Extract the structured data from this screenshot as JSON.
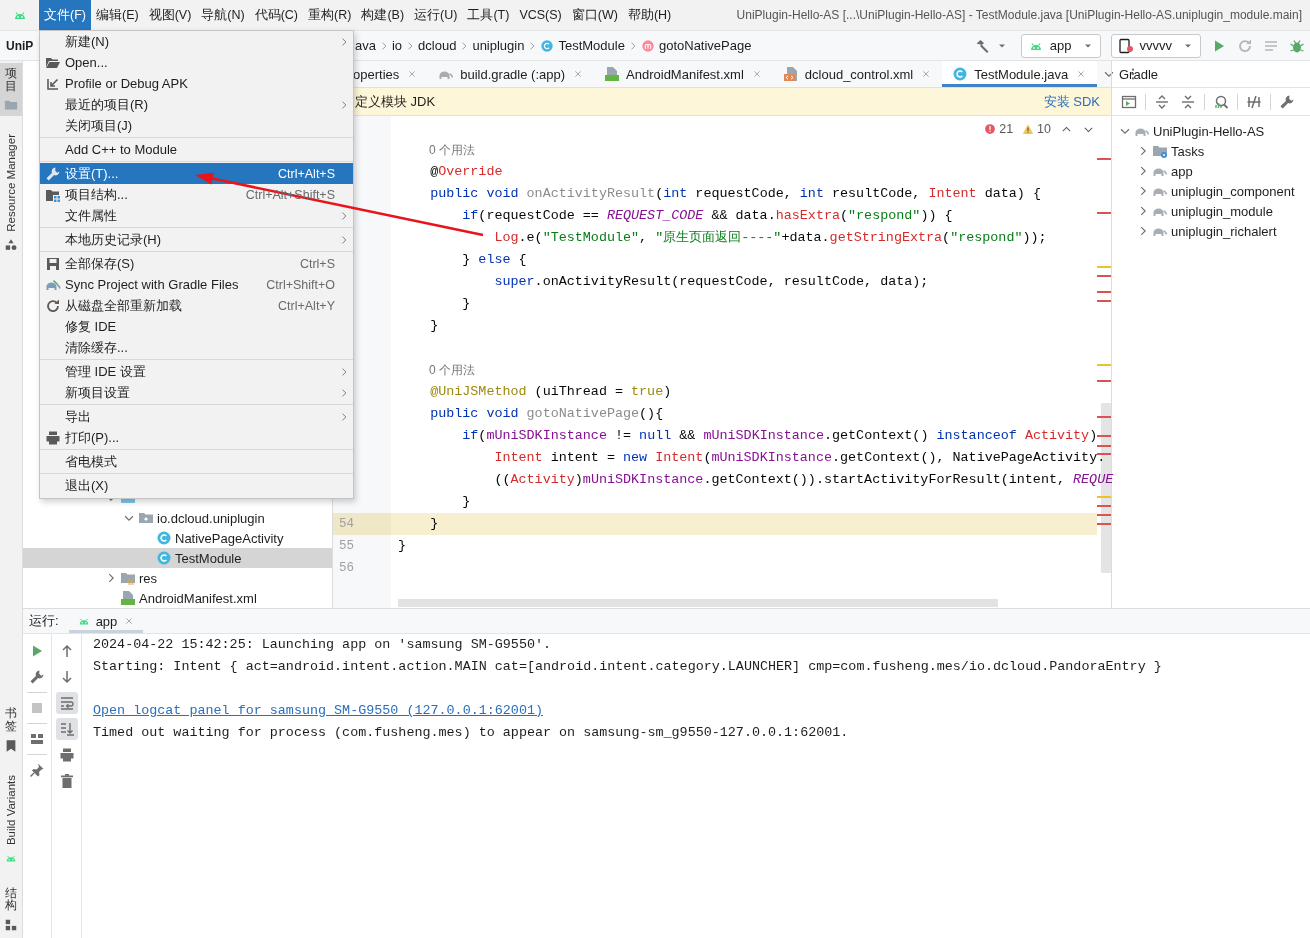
{
  "menubar": {
    "items": [
      {
        "label": "文件(F)",
        "selected": true
      },
      {
        "label": "编辑(E)",
        "selected": false
      },
      {
        "label": "视图(V)",
        "selected": false
      },
      {
        "label": "导航(N)",
        "selected": false
      },
      {
        "label": "代码(C)",
        "selected": false
      },
      {
        "label": "重构(R)",
        "selected": false
      },
      {
        "label": "构建(B)",
        "selected": false
      },
      {
        "label": "运行(U)",
        "selected": false
      },
      {
        "label": "工具(T)",
        "selected": false
      },
      {
        "label": "VCS(S)",
        "selected": false
      },
      {
        "label": "窗口(W)",
        "selected": false
      },
      {
        "label": "帮助(H)",
        "selected": false
      }
    ],
    "title": "UniPlugin-Hello-AS [...\\UniPlugin-Hello-AS] - TestModule.java [UniPlugin-Hello-AS.uniplugin_module.main]"
  },
  "navbar": {
    "project": "UniP",
    "breadcrumbs": [
      {
        "label": "ava"
      },
      {
        "label": "io"
      },
      {
        "label": "dcloud"
      },
      {
        "label": "uniplugin"
      },
      {
        "label": "TestModule",
        "kind": "class"
      },
      {
        "label": "gotoNativePage",
        "kind": "method"
      }
    ],
    "run_config": "app",
    "device": "vvvvv"
  },
  "left_strip": {
    "top": [
      {
        "label": "项目",
        "kind": "cjk",
        "selected": true
      },
      {
        "label": "Resource Manager",
        "kind": "latin",
        "selected": false
      }
    ],
    "bottom": [
      {
        "label": "书签",
        "kind": "cjk",
        "selected": false
      },
      {
        "label": "Build Variants",
        "kind": "latin",
        "selected": false
      },
      {
        "label": "结构",
        "kind": "cjk",
        "selected": false
      }
    ]
  },
  "project_tree": [
    {
      "kind": "javafolder",
      "expanded": true,
      "children": [
        {
          "label": "io.dcloud.uniplugin",
          "kind": "package",
          "expanded": true,
          "selected": false,
          "children": [
            {
              "label": "NativePageActivity",
              "kind": "class",
              "selected": false
            },
            {
              "label": "TestModule",
              "kind": "class",
              "selected": true
            }
          ]
        }
      ]
    },
    {
      "label": "res",
      "kind": "res",
      "expanded": false,
      "selected": false
    },
    {
      "label": "AndroidManifest.xml",
      "kind": "manifest",
      "selected": false
    }
  ],
  "editor_tabs": [
    {
      "label": "operties",
      "selected": false
    },
    {
      "label": "build.gradle (:app)",
      "kind": "gradle",
      "selected": false
    },
    {
      "label": "AndroidManifest.xml",
      "kind": "manifest",
      "selected": false
    },
    {
      "label": "dcloud_control.xml",
      "kind": "xml",
      "selected": false
    },
    {
      "label": "TestModule.java",
      "kind": "class",
      "selected": true
    }
  ],
  "banner": {
    "message": "定义模块 JDK",
    "action": "安装 SDK"
  },
  "inspections": {
    "errors": "21",
    "warnings": "10"
  },
  "code_lines": [
    {
      "kind": "hint",
      "text": "0 个用法"
    },
    {
      "kind": "code",
      "current": false,
      "tokens": [
        {
          "t": "    @",
          "kind": "plain"
        },
        {
          "t": "Override",
          "kind": "err"
        }
      ]
    },
    {
      "kind": "code",
      "current": false,
      "tokens": [
        {
          "t": "    public void ",
          "kind": "kw"
        },
        {
          "t": "onActivityResult",
          "kind": "unused"
        },
        {
          "t": "(",
          "kind": "plain"
        },
        {
          "t": "int ",
          "kind": "kw"
        },
        {
          "t": "requestCode, ",
          "kind": "plain"
        },
        {
          "t": "int ",
          "kind": "kw"
        },
        {
          "t": "resultCode, ",
          "kind": "plain"
        },
        {
          "t": "Intent ",
          "kind": "err"
        },
        {
          "t": "data) {",
          "kind": "plain"
        }
      ]
    },
    {
      "kind": "code",
      "current": false,
      "tokens": [
        {
          "t": "        if",
          "kind": "kw"
        },
        {
          "t": "(requestCode == ",
          "kind": "plain"
        },
        {
          "t": "REQUEST_CODE",
          "kind": "const"
        },
        {
          "t": " && data.",
          "kind": "plain"
        },
        {
          "t": "hasExtra",
          "kind": "err"
        },
        {
          "t": "(",
          "kind": "plain"
        },
        {
          "t": "\"respond\"",
          "kind": "str"
        },
        {
          "t": ")) {",
          "kind": "plain"
        }
      ]
    },
    {
      "kind": "code",
      "current": false,
      "tokens": [
        {
          "t": "            Log",
          "kind": "err"
        },
        {
          "t": ".e(",
          "kind": "plain"
        },
        {
          "t": "\"TestModule\"",
          "kind": "str"
        },
        {
          "t": ", ",
          "kind": "plain"
        },
        {
          "t": "\"原生页面返回----\"",
          "kind": "str"
        },
        {
          "t": "+data.",
          "kind": "plain"
        },
        {
          "t": "getStringExtra",
          "kind": "err"
        },
        {
          "t": "(",
          "kind": "plain"
        },
        {
          "t": "\"respond\"",
          "kind": "str"
        },
        {
          "t": "));",
          "kind": "plain"
        }
      ]
    },
    {
      "kind": "code",
      "current": false,
      "tokens": [
        {
          "t": "        } ",
          "kind": "plain"
        },
        {
          "t": "else",
          "kind": "kw"
        },
        {
          "t": " {",
          "kind": "plain"
        }
      ]
    },
    {
      "kind": "code",
      "current": false,
      "tokens": [
        {
          "t": "            super",
          "kind": "kw"
        },
        {
          "t": ".onActivityResult(requestCode, resultCode, data);",
          "kind": "plain"
        }
      ]
    },
    {
      "kind": "code",
      "current": false,
      "tokens": [
        {
          "t": "        }",
          "kind": "plain"
        }
      ]
    },
    {
      "kind": "code",
      "current": false,
      "tokens": [
        {
          "t": "    }",
          "kind": "plain"
        }
      ]
    },
    {
      "kind": "blank"
    },
    {
      "kind": "hint",
      "text": "0 个用法"
    },
    {
      "kind": "code",
      "current": false,
      "tokens": [
        {
          "t": "    @UniJSMethod",
          "kind": "ann"
        },
        {
          "t": " (uiThread = ",
          "kind": "plain"
        },
        {
          "t": "true",
          "kind": "ann"
        },
        {
          "t": ")",
          "kind": "plain"
        }
      ]
    },
    {
      "kind": "code",
      "current": false,
      "tokens": [
        {
          "t": "    public void ",
          "kind": "kw"
        },
        {
          "t": "gotoNativePage",
          "kind": "unused"
        },
        {
          "t": "(){",
          "kind": "plain"
        }
      ]
    },
    {
      "kind": "code",
      "current": false,
      "tokens": [
        {
          "t": "        if",
          "kind": "kw"
        },
        {
          "t": "(",
          "kind": "plain"
        },
        {
          "t": "mUniSDKInstance",
          "kind": "field"
        },
        {
          "t": " != ",
          "kind": "plain"
        },
        {
          "t": "null",
          "kind": "kw"
        },
        {
          "t": " && ",
          "kind": "plain"
        },
        {
          "t": "mUniSDKInstance",
          "kind": "field"
        },
        {
          "t": ".getContext() ",
          "kind": "plain"
        },
        {
          "t": "instanceof ",
          "kind": "kw"
        },
        {
          "t": "Activity",
          "kind": "err"
        },
        {
          "t": ")",
          "kind": "plain"
        }
      ]
    },
    {
      "kind": "code",
      "current": false,
      "tokens": [
        {
          "t": "            Intent ",
          "kind": "err"
        },
        {
          "t": "intent = ",
          "kind": "plain"
        },
        {
          "t": "new ",
          "kind": "kw"
        },
        {
          "t": "Intent",
          "kind": "err"
        },
        {
          "t": "(",
          "kind": "plain"
        },
        {
          "t": "mUniSDKInstance",
          "kind": "field"
        },
        {
          "t": ".getContext(), NativePageActivity.",
          "kind": "plain"
        }
      ]
    },
    {
      "kind": "code",
      "current": false,
      "tokens": [
        {
          "t": "            ((",
          "kind": "plain"
        },
        {
          "t": "Activity",
          "kind": "err"
        },
        {
          "t": ")",
          "kind": "plain"
        },
        {
          "t": "mUniSDKInstance",
          "kind": "field"
        },
        {
          "t": ".getContext()).startActivityForResult(intent, ",
          "kind": "plain"
        },
        {
          "t": "REQUE",
          "kind": "const"
        }
      ]
    },
    {
      "kind": "code",
      "current": false,
      "tokens": [
        {
          "t": "        }",
          "kind": "plain"
        }
      ]
    },
    {
      "kind": "code",
      "number": "54",
      "current": true,
      "tokens": [
        {
          "t": "    }",
          "kind": "plain"
        }
      ]
    },
    {
      "kind": "code",
      "number": "55",
      "current": false,
      "tokens": [
        {
          "t": "}",
          "kind": "plain"
        }
      ]
    },
    {
      "kind": "blank",
      "number": "56"
    }
  ],
  "gradle": {
    "title": "Gradle",
    "tree": [
      {
        "label": "UniPlugin-Hello-AS",
        "kind": "gradle",
        "expanded": true,
        "children": [
          {
            "label": "Tasks",
            "kind": "tasks",
            "expanded": false
          },
          {
            "label": "app",
            "kind": "gradle",
            "expanded": false
          },
          {
            "label": "uniplugin_component",
            "kind": "gradle",
            "expanded": false
          },
          {
            "label": "uniplugin_module",
            "kind": "gradle",
            "expanded": false
          },
          {
            "label": "uniplugin_richalert",
            "kind": "gradle",
            "expanded": false
          }
        ]
      }
    ]
  },
  "run_panel": {
    "title": "运行:",
    "tabs": [
      {
        "label": "app",
        "selected": true
      }
    ],
    "console": [
      {
        "kind": "text",
        "text": "2024-04-22 15:42:25: Launching app on 'samsung SM-G9550'."
      },
      {
        "kind": "text",
        "text": "Starting: Intent { act=android.intent.action.MAIN cat=[android.intent.category.LAUNCHER] cmp=com.fusheng.mes/io.dcloud.PandoraEntry }"
      },
      {
        "kind": "blank"
      },
      {
        "kind": "link",
        "text": "Open logcat panel for samsung SM-G9550 (127.0.0.1:62001)"
      },
      {
        "kind": "text",
        "text": "Timed out waiting for process (com.fusheng.mes) to appear on samsung-sm_g9550-127.0.0.1:62001."
      }
    ]
  },
  "file_menu": {
    "groups": [
      [
        {
          "label": "新建(N)",
          "submenu": true,
          "selected": false
        },
        {
          "label": "Open...",
          "kind": "folderopen",
          "submenu": false,
          "selected": false
        },
        {
          "label": "Profile or Debug APK",
          "kind": "profile",
          "submenu": false,
          "selected": false
        },
        {
          "label": "最近的项目(R)",
          "submenu": true,
          "selected": false
        },
        {
          "label": "关闭项目(J)",
          "submenu": false,
          "selected": false
        }
      ],
      [
        {
          "label": "Add C++ to Module",
          "submenu": false,
          "selected": false
        }
      ],
      [
        {
          "label": "设置(T)...",
          "kind": "wrench",
          "shortcut": "Ctrl+Alt+S",
          "submenu": false,
          "selected": true
        },
        {
          "label": "项目结构...",
          "kind": "structure",
          "shortcut": "Ctrl+Alt+Shift+S",
          "submenu": false,
          "selected": false
        },
        {
          "label": "文件属性",
          "submenu": true,
          "selected": false
        }
      ],
      [
        {
          "label": "本地历史记录(H)",
          "submenu": true,
          "selected": false
        }
      ],
      [
        {
          "label": "全部保存(S)",
          "kind": "save",
          "shortcut": "Ctrl+S",
          "submenu": false,
          "selected": false
        },
        {
          "label": "Sync Project with Gradle Files",
          "kind": "sync",
          "shortcut": "Ctrl+Shift+O",
          "submenu": false,
          "selected": false
        },
        {
          "label": "从磁盘全部重新加载",
          "kind": "refresh",
          "shortcut": "Ctrl+Alt+Y",
          "submenu": false,
          "selected": false
        },
        {
          "label": "修复 IDE",
          "submenu": false,
          "selected": false
        },
        {
          "label": "清除缓存...",
          "submenu": false,
          "selected": false
        }
      ],
      [
        {
          "label": "管理 IDE 设置",
          "submenu": true,
          "selected": false
        },
        {
          "label": "新项目设置",
          "submenu": true,
          "selected": false
        }
      ],
      [
        {
          "label": "导出",
          "submenu": true,
          "selected": false
        },
        {
          "label": "打印(P)...",
          "kind": "print",
          "submenu": false,
          "selected": false
        }
      ],
      [
        {
          "label": "省电模式",
          "submenu": false,
          "selected": false
        }
      ],
      [
        {
          "label": "退出(X)",
          "submenu": false,
          "selected": false
        }
      ]
    ]
  }
}
